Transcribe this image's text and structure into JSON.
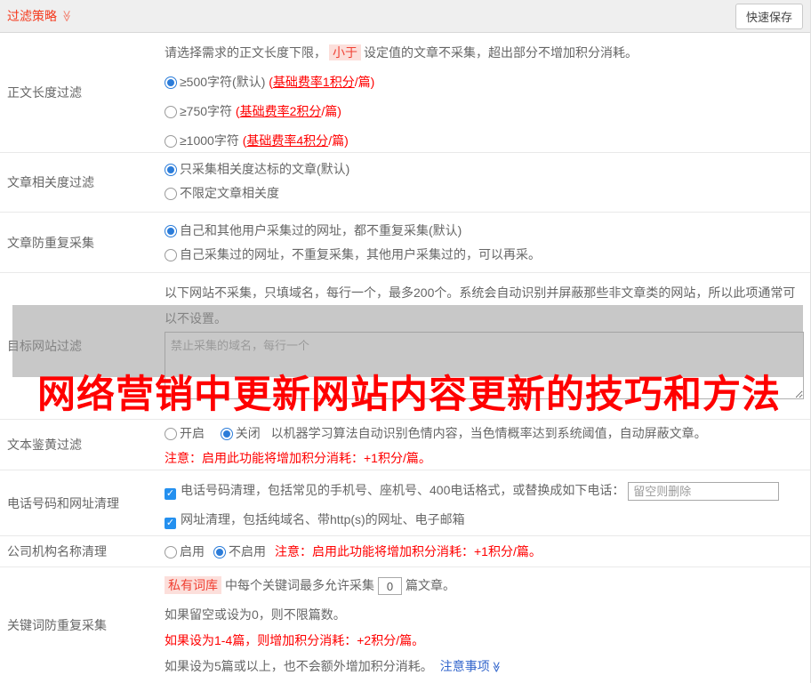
{
  "icons": {
    "check": "✓",
    "chevron_double": "≫"
  },
  "colors": {
    "accent_red": "#f53a1e",
    "note_red": "#ff0000",
    "link_blue": "#3366cc",
    "radio_blue": "#2b7cd9",
    "checkbox_blue": "#2490ef",
    "highlight_bg": "#fcdfdb",
    "highlight_text": "#f04134",
    "overlay_gray": "#c6c6c6",
    "header_bg": "#efefef"
  },
  "header": {
    "title": "过滤策略",
    "save_button": "快速保存"
  },
  "watermark": "网络营销中更新网站内容更新的技巧和方法",
  "rows": {
    "length": {
      "label": "正文长度过滤",
      "intro_pre": "请选择需求的正文长度下限，",
      "intro_hl": "小于",
      "intro_post": "设定值的文章不采集，超出部分不增加积分消耗。",
      "options": [
        {
          "text": "≥500字符(默认)",
          "fee_pre": " (",
          "fee_u": "基础费率1积分",
          "fee_post": "/篇)"
        },
        {
          "text": "≥750字符",
          "fee_pre": " (",
          "fee_u": "基础费率2积分",
          "fee_post": "/篇)"
        },
        {
          "text": "≥1000字符",
          "fee_pre": " (",
          "fee_u": "基础费率4积分",
          "fee_post": "/篇)"
        }
      ]
    },
    "relevance": {
      "label": "文章相关度过滤",
      "options": [
        "只采集相关度达标的文章(默认)",
        "不限定文章相关度"
      ]
    },
    "dedup": {
      "label": "文章防重复采集",
      "options": [
        "自己和其他用户采集过的网址，都不重复采集(默认)",
        "自己采集过的网址，不重复采集，其他用户采集过的，可以再采。"
      ]
    },
    "target": {
      "label": "目标网站过滤",
      "desc": "以下网站不采集，只填域名，每行一个，最多200个。系统会自动识别并屏蔽那些非文章类的网站，所以此项通常可以不设置。",
      "textarea_placeholder": "禁止采集的域名，每行一个"
    },
    "porn": {
      "label": "文本鉴黄过滤",
      "option_on": "开启",
      "option_off": "关闭",
      "desc": "以机器学习算法自动识别色情内容，当色情概率达到系统阈值，自动屏蔽文章。",
      "note": "注意：启用此功能将增加积分消耗：+1积分/篇。"
    },
    "phone": {
      "label": "电话号码和网址清理",
      "cb1": "电话号码清理，包括常见的手机号、座机号、400电话格式，或替换成如下电话：",
      "input_placeholder": "留空则删除",
      "cb2": "网址清理，包括纯域名、带http(s)的网址、电子邮箱"
    },
    "company": {
      "label": "公司机构名称清理",
      "option_on": "启用",
      "option_off": "不启用",
      "note": "注意：启用此功能将增加积分消耗：+1积分/篇。"
    },
    "keyword": {
      "label": "关键词防重复采集",
      "tag": "私有词库",
      "line1_mid": "中每个关键词最多允许采集",
      "input_value": "0",
      "line1_post": "篇文章。",
      "line2": "如果留空或设为0，则不限篇数。",
      "line3": "如果设为1-4篇，则增加积分消耗：+2积分/篇。",
      "line4": "如果设为5篇或以上，也不会额外增加积分消耗。",
      "link": "注意事项"
    }
  }
}
